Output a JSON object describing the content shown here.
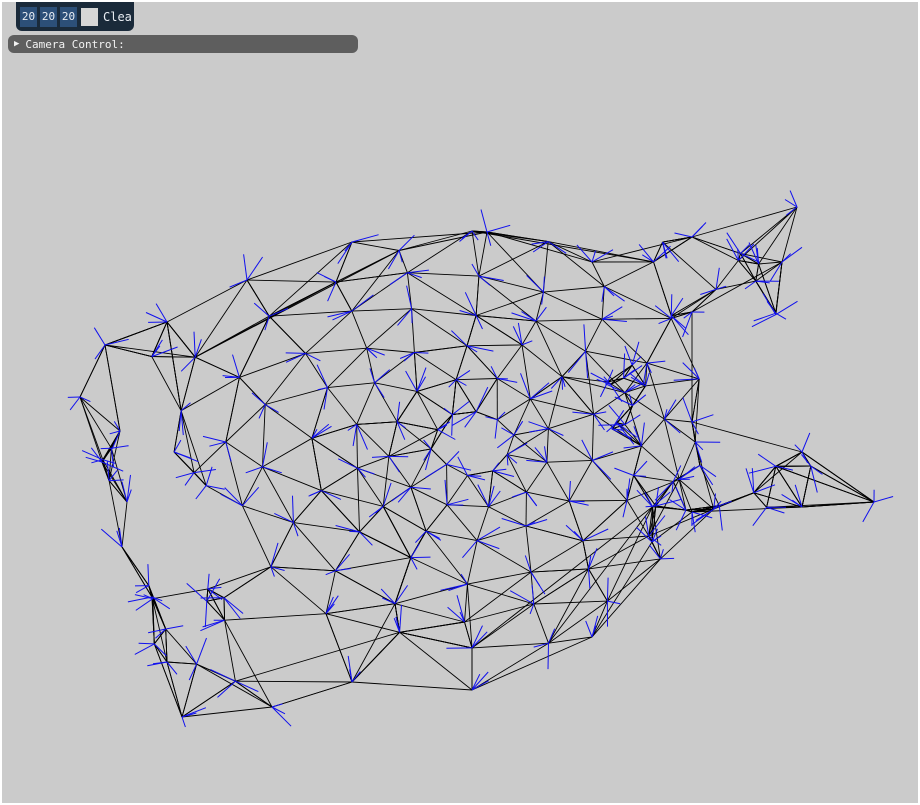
{
  "toolbar": {
    "r": "20",
    "g": "20",
    "b": "20",
    "swatch_color": "#d6d6d6",
    "clear_label": "Clear"
  },
  "camera_panel": {
    "arrow": "▶",
    "label": "Camera Control:"
  },
  "colors": {
    "viewport_background": "#cbcbcb",
    "wire_color": "#000000",
    "normal_color": "#1010ee"
  }
}
